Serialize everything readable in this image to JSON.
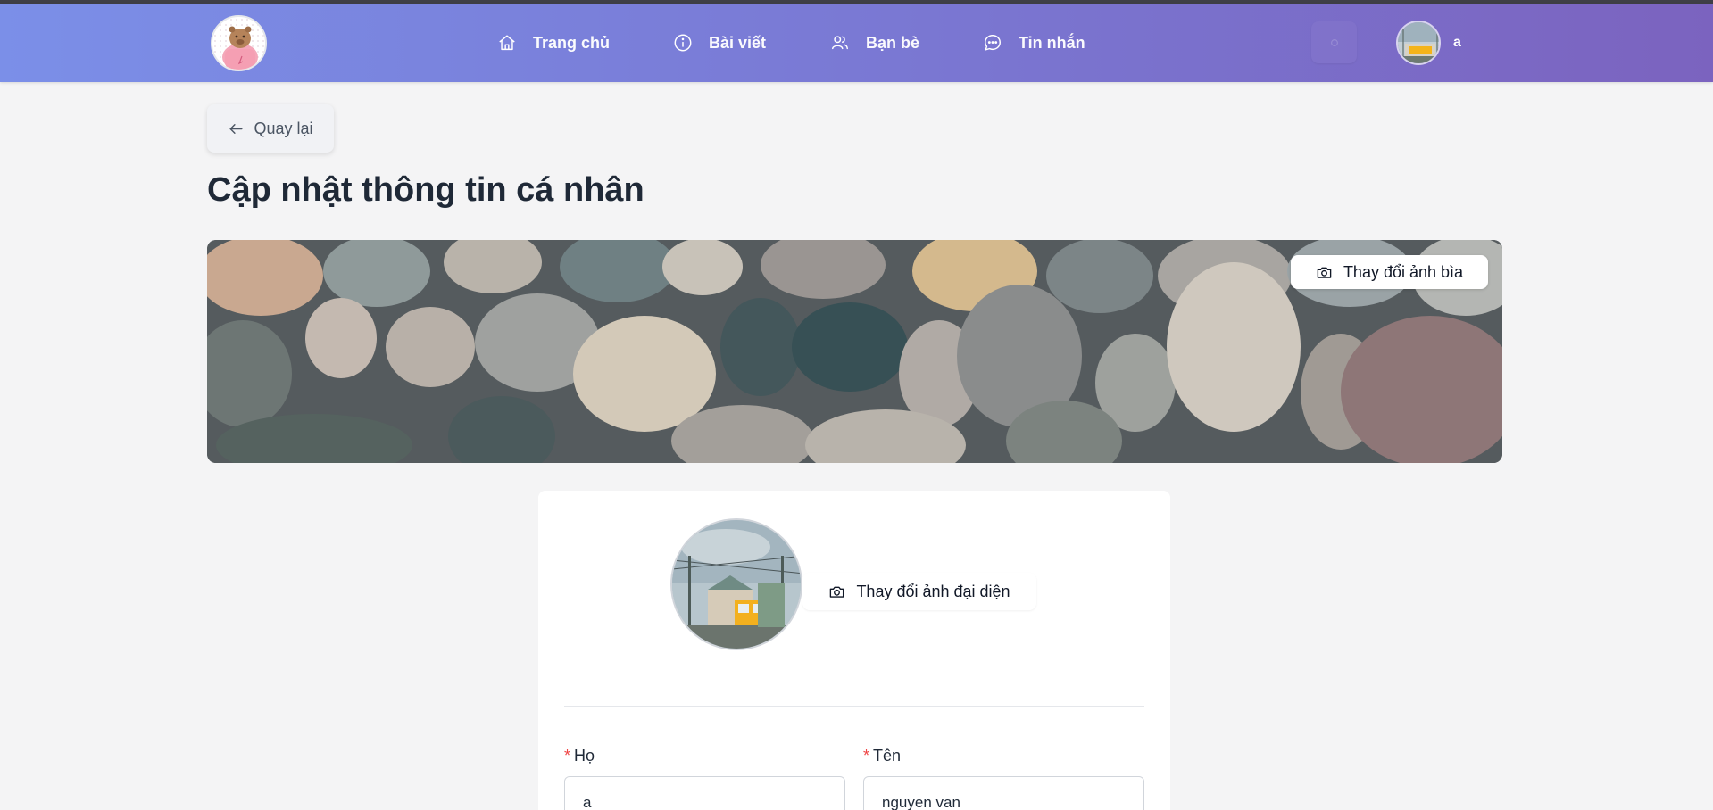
{
  "nav": {
    "items": [
      {
        "label": "Trang chủ",
        "icon": "home-icon"
      },
      {
        "label": "Bài viết",
        "icon": "info-icon"
      },
      {
        "label": "Bạn bè",
        "icon": "users-icon"
      },
      {
        "label": "Tin nhắn",
        "icon": "message-icon"
      }
    ],
    "user_name": "a"
  },
  "page": {
    "back_label": "Quay lại",
    "title": "Cập nhật thông tin cá nhân",
    "cover_button": "Thay đổi ảnh bìa",
    "avatar_button": "Thay đổi ảnh đại diện"
  },
  "form": {
    "last_name": {
      "label": "Họ",
      "value": "a",
      "required_mark": "*"
    },
    "first_name": {
      "label": "Tên",
      "value": "nguyen van",
      "required_mark": "*"
    }
  },
  "colors": {
    "nav_gradient_start": "#7b8fe8",
    "nav_gradient_end": "#7b63bf",
    "required": "#ef4444",
    "page_bg": "#f4f4f5"
  }
}
